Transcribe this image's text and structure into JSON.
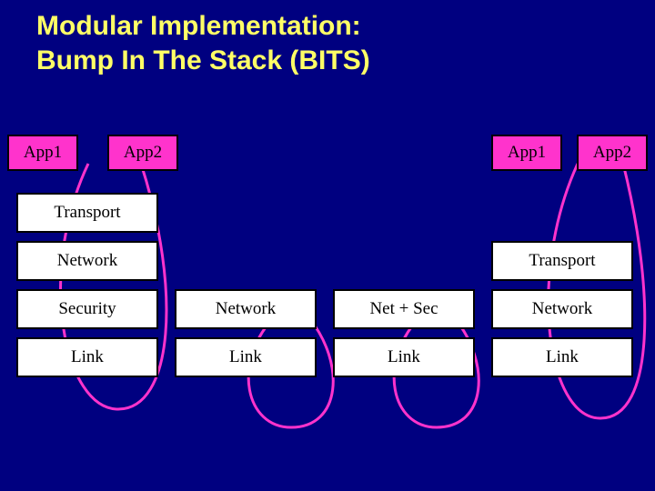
{
  "title_line1": "Modular Implementation:",
  "title_line2": "Bump In The Stack (BITS)",
  "left": {
    "app1": "App1",
    "app2": "App2",
    "transport": "Transport",
    "network": "Network",
    "security": "Security",
    "link": "Link"
  },
  "mid1": {
    "network": "Network",
    "link": "Link"
  },
  "mid2": {
    "netsec": "Net + Sec",
    "link": "Link"
  },
  "right": {
    "app1": "App1",
    "app2": "App2",
    "transport": "Transport",
    "network": "Network",
    "link": "Link"
  }
}
